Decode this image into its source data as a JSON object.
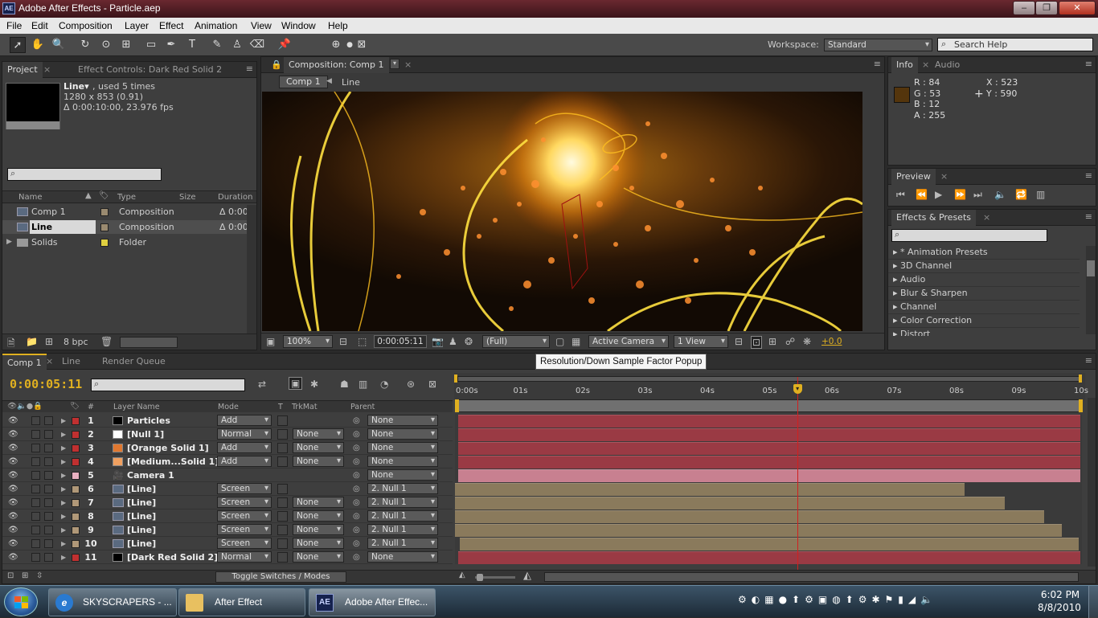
{
  "window": {
    "app_icon": "AE",
    "title": "Adobe After Effects - Particle.aep",
    "min": "–",
    "max": "❐",
    "close": "✕"
  },
  "menu": [
    "File",
    "Edit",
    "Composition",
    "Layer",
    "Effect",
    "Animation",
    "View",
    "Window",
    "Help"
  ],
  "workspace": {
    "label": "Workspace:",
    "value": "Standard",
    "search_placeholder": "Search Help"
  },
  "project": {
    "tab": "Project",
    "effect_controls_tab": "Effect Controls: Dark Red Solid 2",
    "item_name": "Line▾",
    "item_used": ", used 5 times",
    "item_size": "1280 x 853 (0.91)",
    "item_duration": "Δ 0:00:10:00, 23.976 fps",
    "columns": {
      "name": "Name",
      "type": "Type",
      "size": "Size",
      "duration": "Duration"
    },
    "items": [
      {
        "name": "Comp 1",
        "type": "Composition",
        "duration": "Δ 0:00",
        "color": "#9a8a70"
      },
      {
        "name": "Line",
        "type": "Composition",
        "duration": "Δ 0:00",
        "color": "#9a8a70"
      },
      {
        "name": "Solids",
        "type": "Folder",
        "duration": "",
        "color": "#e0d040"
      }
    ],
    "bpc": "8 bpc"
  },
  "composition": {
    "tab": "Composition: Comp 1",
    "crumb1": "Comp 1",
    "crumb2": "Line",
    "zoom": "100%",
    "timecode": "0:00:05:11",
    "resolution": "(Full)",
    "camera": "Active Camera",
    "views": "1 View",
    "exposure": "+0.0",
    "tooltip": "Resolution/Down Sample Factor Popup"
  },
  "info": {
    "tab": "Info",
    "audio_tab": "Audio",
    "r": "R : 84",
    "g": "G : 53",
    "b": "B : 12",
    "a": "A : 255",
    "x": "X : 523",
    "y": "Y : 590",
    "swatch": "#54350c"
  },
  "preview": {
    "tab": "Preview"
  },
  "effects": {
    "tab": "Effects & Presets",
    "items": [
      "* Animation Presets",
      "3D Channel",
      "Audio",
      "Blur & Sharpen",
      "Channel",
      "Color Correction",
      "Distort"
    ]
  },
  "timeline": {
    "tabs": [
      "Comp 1",
      "Line",
      "Render Queue"
    ],
    "timecode": "0:00:05:11",
    "columns": {
      "layer_name": "Layer Name",
      "mode": "Mode",
      "t": "T",
      "trkmat": "TrkMat",
      "parent": "Parent"
    },
    "ruler": [
      "0:00s",
      "01s",
      "02s",
      "03s",
      "04s",
      "05s",
      "06s",
      "07s",
      "08s",
      "09s",
      "10s"
    ],
    "toggle_label": "Toggle Switches / Modes",
    "playhead_fraction": 0.546,
    "layers": [
      {
        "num": "1",
        "name": "Particles",
        "mode": "Add",
        "trk": "",
        "parent": "None",
        "lbl": "#c03030",
        "icon": "#000000",
        "bar": "#9a3a44",
        "start": 0.005,
        "end": 1.0
      },
      {
        "num": "2",
        "name": "[Null 1]",
        "mode": "Normal",
        "trk": "None",
        "parent": "None",
        "lbl": "#c03030",
        "icon": "#ffffff",
        "bar": "#9a3a44",
        "start": 0.005,
        "end": 1.0
      },
      {
        "num": "3",
        "name": "[Orange Solid 1]",
        "mode": "Add",
        "trk": "None",
        "parent": "None",
        "lbl": "#c03030",
        "icon": "#e07830",
        "bar": "#9a3a44",
        "start": 0.005,
        "end": 1.0
      },
      {
        "num": "4",
        "name": "[Medium...Solid 1]",
        "mode": "Add",
        "trk": "None",
        "parent": "None",
        "lbl": "#c03030",
        "icon": "#f0a060",
        "bar": "#9a3a44",
        "start": 0.005,
        "end": 1.0
      },
      {
        "num": "5",
        "name": "Camera 1",
        "mode": "",
        "trk": "",
        "parent": "None",
        "lbl": "#e8b0c0",
        "icon": "cam",
        "bar": "#c88090",
        "start": 0.005,
        "end": 1.0
      },
      {
        "num": "6",
        "name": "[Line]",
        "mode": "Screen",
        "trk": "",
        "parent": "2. Null 1",
        "lbl": "#b09878",
        "icon": "comp",
        "bar": "#8a7a5c",
        "start": 0.0,
        "end": 0.815
      },
      {
        "num": "7",
        "name": "[Line]",
        "mode": "Screen",
        "trk": "None",
        "parent": "2. Null 1",
        "lbl": "#b09878",
        "icon": "comp",
        "bar": "#8a7a5c",
        "start": 0.0,
        "end": 0.88
      },
      {
        "num": "8",
        "name": "[Line]",
        "mode": "Screen",
        "trk": "None",
        "parent": "2. Null 1",
        "lbl": "#b09878",
        "icon": "comp",
        "bar": "#8a7a5c",
        "start": 0.0,
        "end": 0.942
      },
      {
        "num": "9",
        "name": "[Line]",
        "mode": "Screen",
        "trk": "None",
        "parent": "2. Null 1",
        "lbl": "#b09878",
        "icon": "comp",
        "bar": "#8a7a5c",
        "start": 0.0,
        "end": 0.97
      },
      {
        "num": "10",
        "name": "[Line]",
        "mode": "Screen",
        "trk": "None",
        "parent": "2. Null 1",
        "lbl": "#b09878",
        "icon": "comp",
        "bar": "#8a7a5c",
        "start": 0.008,
        "end": 0.998
      },
      {
        "num": "11",
        "name": "[Dark Red Solid 2]",
        "mode": "Normal",
        "trk": "None",
        "parent": "None",
        "lbl": "#c03030",
        "icon": "#000000",
        "bar": "#9a3a44",
        "start": 0.005,
        "end": 1.0
      }
    ]
  },
  "taskbar": {
    "items": [
      "SKYSCRAPERS - ...",
      "After Effect",
      "Adobe After Effec..."
    ],
    "time": "6:02 PM",
    "date": "8/8/2010"
  }
}
